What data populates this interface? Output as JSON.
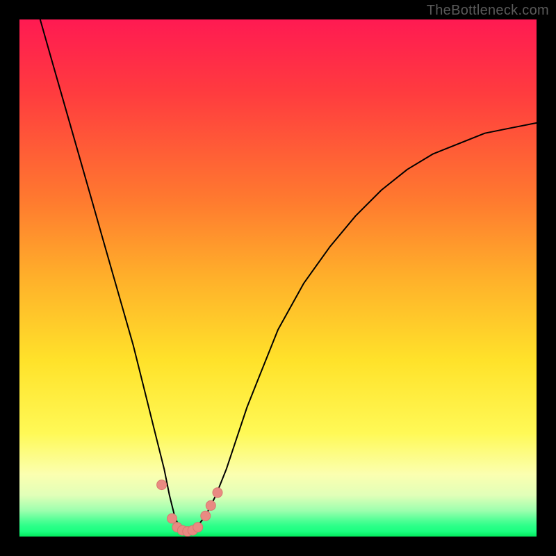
{
  "attribution_text": "TheBottleneck.com",
  "colors": {
    "frame": "#000000",
    "curve": "#000000",
    "marker_fill": "#e98a82",
    "marker_stroke": "#d8776f",
    "gradient_stops": [
      "#ff1a52",
      "#ff3b3f",
      "#ff7a2f",
      "#ffb02a",
      "#ffe22a",
      "#fff956",
      "#fbffb0",
      "#e1ffb8",
      "#9cffae",
      "#4cff94",
      "#2bff88",
      "#1bff80",
      "#02e85d"
    ]
  },
  "chart_data": {
    "type": "line",
    "title": "",
    "subtitle": "",
    "xlabel": "",
    "ylabel": "",
    "xlim": [
      0,
      100
    ],
    "ylim": [
      0,
      100
    ],
    "x": [
      4,
      6,
      8,
      10,
      12,
      14,
      16,
      18,
      20,
      22,
      24,
      26,
      28,
      29,
      30,
      31,
      32,
      33,
      34,
      36,
      38,
      40,
      42,
      44,
      46,
      50,
      55,
      60,
      65,
      70,
      75,
      80,
      85,
      90,
      95,
      100
    ],
    "values": [
      100,
      93,
      86,
      79,
      72,
      65,
      58,
      51,
      44,
      37,
      29,
      21,
      13,
      8,
      4,
      1.5,
      1,
      1,
      1.5,
      4,
      8,
      13,
      19,
      25,
      30,
      40,
      49,
      56,
      62,
      67,
      71,
      74,
      76,
      78,
      79,
      80
    ],
    "markers": {
      "x": [
        27.5,
        29.5,
        30.5,
        31.5,
        32.5,
        33.5,
        34.5,
        36.0,
        37.0,
        38.3
      ],
      "y": [
        10.0,
        3.5,
        1.8,
        1.2,
        1.0,
        1.2,
        1.8,
        4.0,
        6.0,
        8.5
      ]
    },
    "legend": [],
    "annotations": []
  }
}
